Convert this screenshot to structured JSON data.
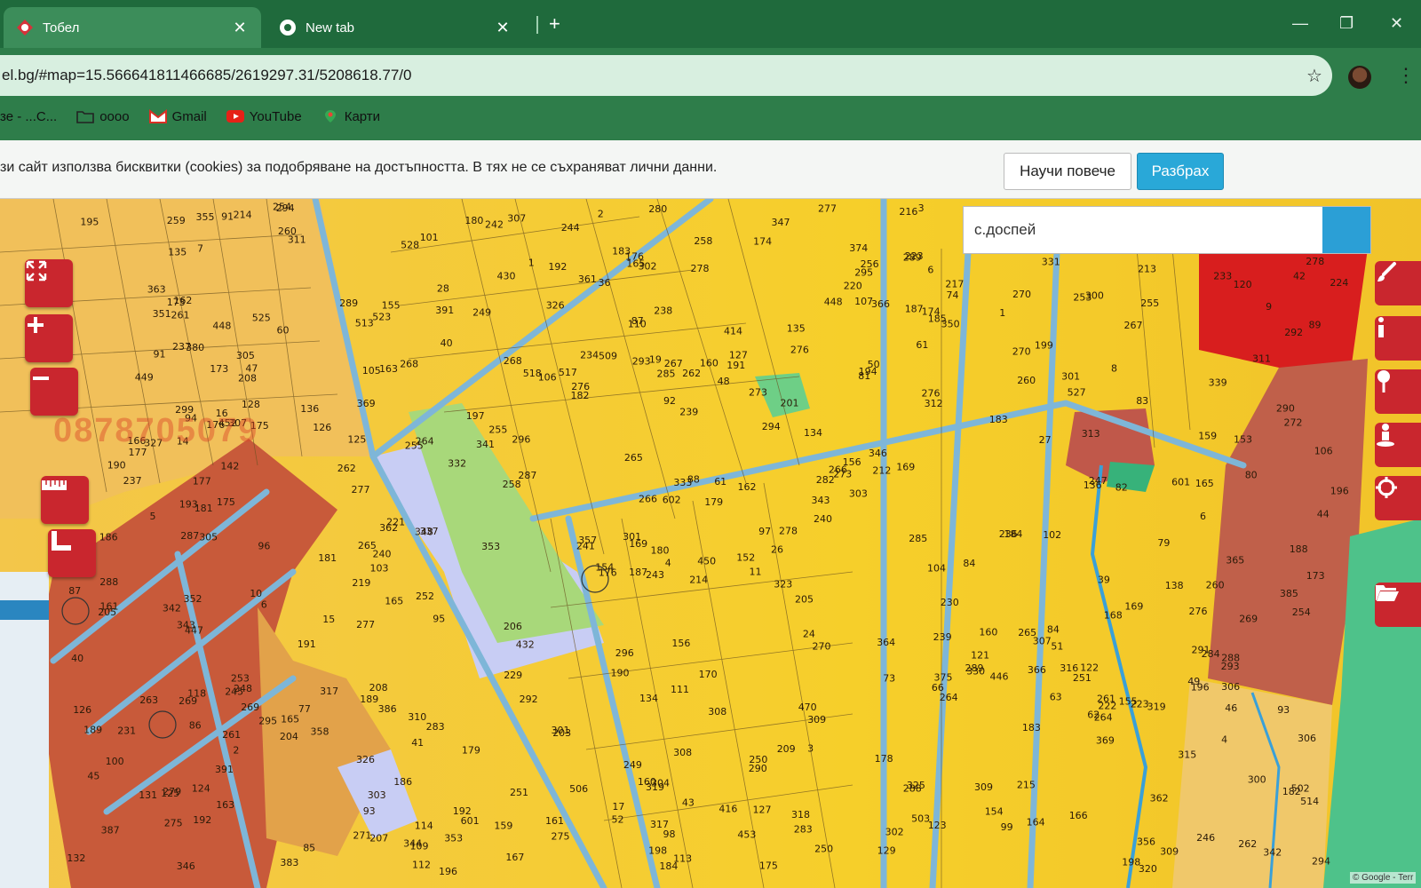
{
  "browser": {
    "tabs": [
      {
        "label": "Тобел",
        "active": true
      },
      {
        "label": "New tab",
        "active": false
      }
    ],
    "url": "el.bg/#map=15.566641811466685/2619297.31/5208618.77/0",
    "bookmarks": [
      {
        "label": "зе - ...C...",
        "icon": "none"
      },
      {
        "label": "оооо",
        "icon": "folder-icon"
      },
      {
        "label": "Gmail",
        "icon": "gmail-icon"
      },
      {
        "label": "YouTube",
        "icon": "youtube-icon"
      },
      {
        "label": "Карти",
        "icon": "maps-icon"
      }
    ]
  },
  "cookie_banner": {
    "message": "зи сайт използва бисквитки (cookies) за подобряване на достъпността. В тях не се съхраняват лични данни.",
    "learn_more": "Научи повече",
    "accept": "Разбрах"
  },
  "map": {
    "search_value": "с.доспей",
    "watermark_text": "0878705079",
    "attribution": "© Google - Terr",
    "left_tools": [
      "fullscreen-icon",
      "zoom-in-icon",
      "zoom-out-icon",
      "ruler-icon",
      "area-measure-icon"
    ],
    "right_tools": [
      "brush-icon",
      "info-icon",
      "pin-icon",
      "street-view-icon",
      "locate-icon",
      "folder-open-icon"
    ],
    "parcel_labels": [
      {
        "t": "214"
      },
      {
        "t": "173"
      },
      {
        "t": "169"
      },
      {
        "t": "279"
      },
      {
        "t": "282"
      },
      {
        "t": "283"
      },
      {
        "t": "289"
      },
      {
        "t": "160"
      },
      {
        "t": "174"
      },
      {
        "t": "278"
      },
      {
        "t": "311"
      },
      {
        "t": "342"
      },
      {
        "t": "175"
      },
      {
        "t": "292"
      },
      {
        "t": "176"
      },
      {
        "t": "276"
      },
      {
        "t": "383"
      },
      {
        "t": "293"
      },
      {
        "t": "294"
      },
      {
        "t": "295"
      },
      {
        "t": "296"
      },
      {
        "t": "275"
      },
      {
        "t": "303"
      },
      {
        "t": "267"
      },
      {
        "t": "273"
      },
      {
        "t": "307"
      },
      {
        "t": "305"
      },
      {
        "t": "302"
      },
      {
        "t": "237"
      },
      {
        "t": "239"
      },
      {
        "t": "272"
      },
      {
        "t": "301"
      },
      {
        "t": "249"
      },
      {
        "t": "266"
      },
      {
        "t": "268"
      },
      {
        "t": "270"
      },
      {
        "t": "310"
      },
      {
        "t": "309"
      },
      {
        "t": "300"
      },
      {
        "t": "265"
      },
      {
        "t": "347"
      },
      {
        "t": "341"
      },
      {
        "t": "262"
      },
      {
        "t": "264"
      },
      {
        "t": "344"
      },
      {
        "t": "343"
      },
      {
        "t": "346"
      },
      {
        "t": "319"
      },
      {
        "t": "240"
      },
      {
        "t": "261"
      },
      {
        "t": "339"
      },
      {
        "t": "330"
      },
      {
        "t": "325"
      },
      {
        "t": "326"
      },
      {
        "t": "260"
      },
      {
        "t": "259"
      },
      {
        "t": "250"
      },
      {
        "t": "255"
      },
      {
        "t": "258"
      },
      {
        "t": "337"
      },
      {
        "t": "327"
      },
      {
        "t": "369"
      },
      {
        "t": "253"
      },
      {
        "t": "254"
      },
      {
        "t": "256"
      },
      {
        "t": "361"
      },
      {
        "t": "333"
      },
      {
        "t": "126"
      },
      {
        "t": "134"
      },
      {
        "t": "159"
      },
      {
        "t": "160"
      },
      {
        "t": "255"
      },
      {
        "t": "125"
      },
      {
        "t": "135"
      },
      {
        "t": "136"
      },
      {
        "t": "161"
      },
      {
        "t": "265"
      },
      {
        "t": "127"
      },
      {
        "t": "162"
      },
      {
        "t": "163"
      },
      {
        "t": "285"
      },
      {
        "t": "288"
      },
      {
        "t": "198"
      },
      {
        "t": "165"
      },
      {
        "t": "170"
      },
      {
        "t": "166"
      },
      {
        "t": "175"
      },
      {
        "t": "178"
      },
      {
        "t": "176"
      },
      {
        "t": "173"
      },
      {
        "t": "169"
      },
      {
        "t": "183"
      },
      {
        "t": "179"
      },
      {
        "t": "196"
      },
      {
        "t": "177"
      },
      {
        "t": "184"
      },
      {
        "t": "187"
      },
      {
        "t": "185"
      },
      {
        "t": "181"
      },
      {
        "t": "180"
      },
      {
        "t": "188"
      },
      {
        "t": "190"
      },
      {
        "t": "191"
      },
      {
        "t": "189"
      },
      {
        "t": "192"
      },
      {
        "t": "266"
      },
      {
        "t": "267"
      },
      {
        "t": "258"
      },
      {
        "t": "260"
      },
      {
        "t": "261"
      },
      {
        "t": "262"
      },
      {
        "t": "241"
      },
      {
        "t": "242"
      },
      {
        "t": "263"
      },
      {
        "t": "243"
      },
      {
        "t": "233"
      },
      {
        "t": "234"
      },
      {
        "t": "244"
      },
      {
        "t": "245"
      },
      {
        "t": "273"
      },
      {
        "t": "268"
      },
      {
        "t": "236"
      },
      {
        "t": "277"
      },
      {
        "t": "246"
      },
      {
        "t": "275"
      },
      {
        "t": "247"
      },
      {
        "t": "237"
      },
      {
        "t": "248"
      },
      {
        "t": "250"
      },
      {
        "t": "264"
      },
      {
        "t": "249"
      },
      {
        "t": "269"
      },
      {
        "t": "251"
      },
      {
        "t": "252"
      },
      {
        "t": "253"
      },
      {
        "t": "254"
      },
      {
        "t": "255"
      },
      {
        "t": "323"
      },
      {
        "t": "142"
      },
      {
        "t": "155"
      },
      {
        "t": "152"
      },
      {
        "t": "156"
      },
      {
        "t": "162"
      },
      {
        "t": "161"
      },
      {
        "t": "164"
      },
      {
        "t": "160"
      },
      {
        "t": "165"
      },
      {
        "t": "159"
      },
      {
        "t": "163"
      },
      {
        "t": "166"
      },
      {
        "t": "167"
      },
      {
        "t": "168"
      },
      {
        "t": "174"
      },
      {
        "t": "238"
      },
      {
        "t": "239"
      },
      {
        "t": "240"
      },
      {
        "t": "276"
      },
      {
        "t": "270"
      },
      {
        "t": "278"
      },
      {
        "t": "280"
      },
      {
        "t": "295"
      },
      {
        "t": "299"
      },
      {
        "t": "296"
      },
      {
        "t": "502"
      },
      {
        "t": "294"
      },
      {
        "t": "320"
      },
      {
        "t": "319"
      },
      {
        "t": "318"
      },
      {
        "t": "374"
      },
      {
        "t": "346"
      },
      {
        "t": "353"
      },
      {
        "t": "448"
      },
      {
        "t": "375"
      },
      {
        "t": "452"
      },
      {
        "t": "449"
      },
      {
        "t": "450"
      },
      {
        "t": "453"
      },
      {
        "t": "14"
      },
      {
        "t": "173"
      },
      {
        "t": "175"
      },
      {
        "t": "176"
      },
      {
        "t": "177"
      },
      {
        "t": "179"
      },
      {
        "t": "180"
      },
      {
        "t": "284"
      },
      {
        "t": "292"
      },
      {
        "t": "285"
      },
      {
        "t": "301"
      },
      {
        "t": "303"
      },
      {
        "t": "304"
      },
      {
        "t": "305"
      },
      {
        "t": "509"
      },
      {
        "t": "316"
      },
      {
        "t": "317"
      },
      {
        "t": "181"
      },
      {
        "t": "182"
      },
      {
        "t": "183"
      },
      {
        "t": "186"
      },
      {
        "t": "187"
      },
      {
        "t": "189"
      },
      {
        "t": "190"
      },
      {
        "t": "331"
      },
      {
        "t": "306"
      },
      {
        "t": "311"
      },
      {
        "t": "332"
      },
      {
        "t": "293"
      },
      {
        "t": "601"
      },
      {
        "t": "203"
      },
      {
        "t": "204"
      },
      {
        "t": "205"
      },
      {
        "t": "206"
      },
      {
        "t": "193"
      },
      {
        "t": "192"
      },
      {
        "t": "191"
      },
      {
        "t": "132"
      },
      {
        "t": "194"
      },
      {
        "t": "207"
      },
      {
        "t": "208"
      },
      {
        "t": "212"
      },
      {
        "t": "213"
      },
      {
        "t": "214"
      },
      {
        "t": "215"
      },
      {
        "t": "216"
      },
      {
        "t": "196"
      },
      {
        "t": "195"
      },
      {
        "t": "219"
      },
      {
        "t": "220"
      },
      {
        "t": "221"
      },
      {
        "t": "287"
      },
      {
        "t": "288"
      },
      {
        "t": "289"
      },
      {
        "t": "290"
      },
      {
        "t": "291"
      },
      {
        "t": "307"
      },
      {
        "t": "308"
      },
      {
        "t": "309"
      },
      {
        "t": "514"
      },
      {
        "t": "513"
      },
      {
        "t": "312"
      },
      {
        "t": "313"
      },
      {
        "t": "517"
      },
      {
        "t": "601"
      },
      {
        "t": "197"
      },
      {
        "t": "198"
      },
      {
        "t": "199"
      },
      {
        "t": "229"
      },
      {
        "t": "209"
      },
      {
        "t": "201"
      },
      {
        "t": "222"
      },
      {
        "t": "223"
      },
      {
        "t": "230"
      },
      {
        "t": "231"
      },
      {
        "t": "224"
      },
      {
        "t": "602"
      },
      {
        "t": "326"
      },
      {
        "t": "518"
      },
      {
        "t": "523"
      },
      {
        "t": "525"
      },
      {
        "t": "348"
      },
      {
        "t": "430"
      },
      {
        "t": "350"
      },
      {
        "t": "351"
      },
      {
        "t": "352"
      },
      {
        "t": "353"
      },
      {
        "t": "342"
      },
      {
        "t": "356"
      },
      {
        "t": "357"
      },
      {
        "t": "366"
      },
      {
        "t": "365"
      },
      {
        "t": "362"
      },
      {
        "t": "363"
      },
      {
        "t": "364"
      },
      {
        "t": "358"
      },
      {
        "t": "309"
      },
      {
        "t": "432"
      },
      {
        "t": "470"
      },
      {
        "t": "306"
      },
      {
        "t": "506"
      },
      {
        "t": "446"
      },
      {
        "t": "447"
      },
      {
        "t": "294"
      },
      {
        "t": "528"
      },
      {
        "t": "527"
      },
      {
        "t": "503"
      },
      {
        "t": "380"
      },
      {
        "t": "300"
      },
      {
        "t": "391"
      },
      {
        "t": "369"
      },
      {
        "t": "4"
      },
      {
        "t": "6"
      },
      {
        "t": "1"
      },
      {
        "t": "2"
      },
      {
        "t": "3"
      },
      {
        "t": "15"
      },
      {
        "t": "16"
      },
      {
        "t": "17"
      },
      {
        "t": "26"
      },
      {
        "t": "27"
      },
      {
        "t": "28"
      },
      {
        "t": "448"
      },
      {
        "t": "276"
      },
      {
        "t": "277"
      },
      {
        "t": "271"
      },
      {
        "t": "287"
      },
      {
        "t": "288"
      },
      {
        "t": "289"
      },
      {
        "t": "278"
      },
      {
        "t": "36"
      },
      {
        "t": "24"
      },
      {
        "t": "52"
      },
      {
        "t": "60"
      },
      {
        "t": "61"
      },
      {
        "t": "62"
      },
      {
        "t": "122"
      },
      {
        "t": "118"
      },
      {
        "t": "114"
      },
      {
        "t": "129"
      },
      {
        "t": "123"
      },
      {
        "t": "77"
      },
      {
        "t": "134"
      },
      {
        "t": "138"
      },
      {
        "t": "391"
      },
      {
        "t": "128"
      },
      {
        "t": "73"
      },
      {
        "t": "63"
      },
      {
        "t": "74"
      },
      {
        "t": "79"
      },
      {
        "t": "136"
      },
      {
        "t": "135"
      },
      {
        "t": "83"
      },
      {
        "t": "84"
      },
      {
        "t": "86"
      },
      {
        "t": "80"
      },
      {
        "t": "82"
      },
      {
        "t": "81"
      },
      {
        "t": "87"
      },
      {
        "t": "88"
      },
      {
        "t": "98"
      },
      {
        "t": "99"
      },
      {
        "t": "100"
      },
      {
        "t": "89"
      },
      {
        "t": "91"
      },
      {
        "t": "92"
      },
      {
        "t": "93"
      },
      {
        "t": "94"
      },
      {
        "t": "95"
      },
      {
        "t": "97"
      },
      {
        "t": "101"
      },
      {
        "t": "102"
      },
      {
        "t": "103"
      },
      {
        "t": "104"
      },
      {
        "t": "105"
      },
      {
        "t": "106"
      },
      {
        "t": "107"
      },
      {
        "t": "109"
      },
      {
        "t": "110"
      },
      {
        "t": "111"
      },
      {
        "t": "112"
      },
      {
        "t": "113"
      },
      {
        "t": "120"
      },
      {
        "t": "121"
      },
      {
        "t": "131"
      },
      {
        "t": "66"
      },
      {
        "t": "153"
      },
      {
        "t": "127"
      },
      {
        "t": "124"
      },
      {
        "t": "125"
      },
      {
        "t": "126"
      },
      {
        "t": "416"
      },
      {
        "t": "154"
      },
      {
        "t": "155"
      },
      {
        "t": "156"
      },
      {
        "t": "414"
      },
      {
        "t": "302"
      },
      {
        "t": "343"
      },
      {
        "t": "169"
      },
      {
        "t": "205"
      },
      {
        "t": "208"
      },
      {
        "t": "217"
      },
      {
        "t": "184"
      },
      {
        "t": "182"
      },
      {
        "t": "183"
      },
      {
        "t": "192"
      },
      {
        "t": "315"
      },
      {
        "t": "301"
      },
      {
        "t": "19"
      },
      {
        "t": "277"
      },
      {
        "t": "276"
      },
      {
        "t": "269"
      },
      {
        "t": "307"
      },
      {
        "t": "186"
      },
      {
        "t": "308"
      },
      {
        "t": "283"
      },
      {
        "t": "362"
      },
      {
        "t": "264"
      },
      {
        "t": "265"
      },
      {
        "t": "317"
      },
      {
        "t": "223"
      },
      {
        "t": "87"
      },
      {
        "t": "84"
      },
      {
        "t": "85"
      },
      {
        "t": "93"
      },
      {
        "t": "91"
      },
      {
        "t": "96"
      },
      {
        "t": "61"
      },
      {
        "t": "106"
      },
      {
        "t": "154"
      },
      {
        "t": "290"
      },
      {
        "t": "165"
      },
      {
        "t": "196"
      },
      {
        "t": "385"
      },
      {
        "t": "387"
      },
      {
        "t": "386"
      },
      {
        "t": "355"
      },
      {
        "t": "165"
      },
      {
        "t": "366"
      },
      {
        "t": "251"
      },
      {
        "t": "260"
      },
      {
        "t": "261"
      },
      {
        "t": "262"
      },
      {
        "t": "269"
      },
      {
        "t": "270"
      },
      {
        "t": "10"
      },
      {
        "t": "11"
      },
      {
        "t": "6"
      },
      {
        "t": "1"
      },
      {
        "t": "2"
      },
      {
        "t": "3"
      },
      {
        "t": "4"
      },
      {
        "t": "5"
      },
      {
        "t": "6"
      },
      {
        "t": "7"
      },
      {
        "t": "8"
      },
      {
        "t": "9"
      },
      {
        "t": "40"
      },
      {
        "t": "40"
      },
      {
        "t": "41"
      },
      {
        "t": "39"
      },
      {
        "t": "42"
      },
      {
        "t": "43"
      },
      {
        "t": "44"
      },
      {
        "t": "45"
      },
      {
        "t": "46"
      },
      {
        "t": "47"
      },
      {
        "t": "48"
      },
      {
        "t": "49"
      },
      {
        "t": "50"
      },
      {
        "t": "51"
      }
    ]
  }
}
